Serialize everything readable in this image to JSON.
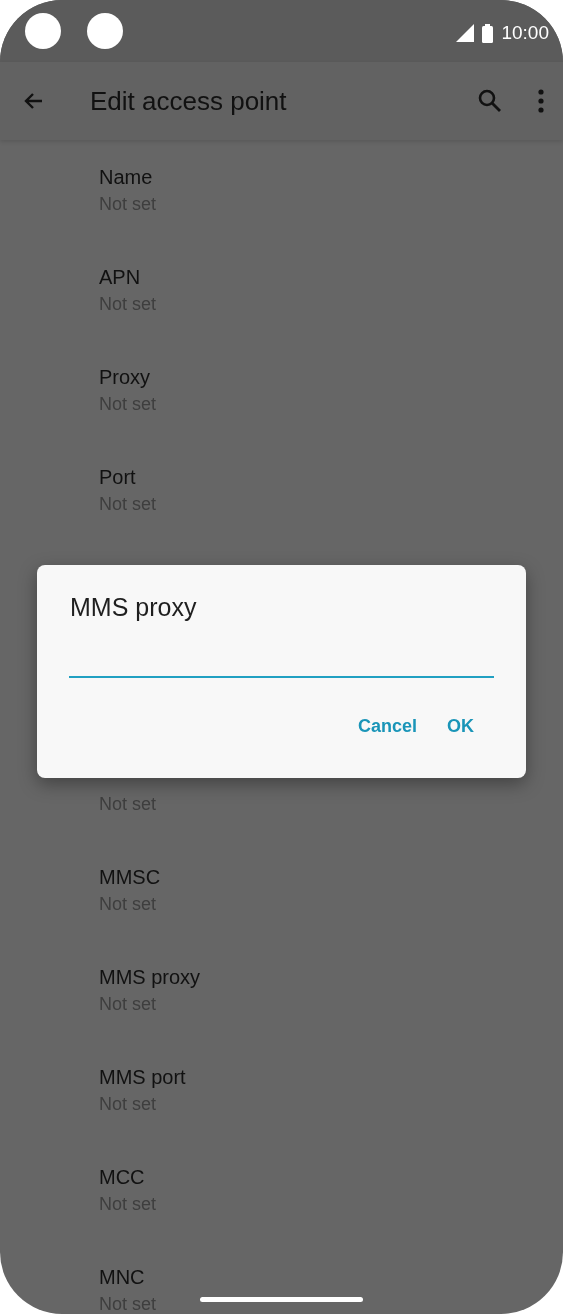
{
  "status_bar": {
    "time": "10:00"
  },
  "app_bar": {
    "title": "Edit access point"
  },
  "settings_before_dialog": [
    {
      "title": "Name",
      "value": "Not set"
    },
    {
      "title": "APN",
      "value": "Not set"
    },
    {
      "title": "Proxy",
      "value": "Not set"
    },
    {
      "title": "Port",
      "value": "Not set"
    }
  ],
  "settings_after_dialog": [
    {
      "value": "Not set"
    },
    {
      "title": "MMSC",
      "value": "Not set"
    },
    {
      "title": "MMS proxy",
      "value": "Not set"
    },
    {
      "title": "MMS port",
      "value": "Not set"
    },
    {
      "title": "MCC",
      "value": "Not set"
    },
    {
      "title": "MNC",
      "value": "Not set"
    }
  ],
  "dialog": {
    "title": "MMS proxy",
    "buttons": [
      "Cancel",
      "OK"
    ]
  }
}
